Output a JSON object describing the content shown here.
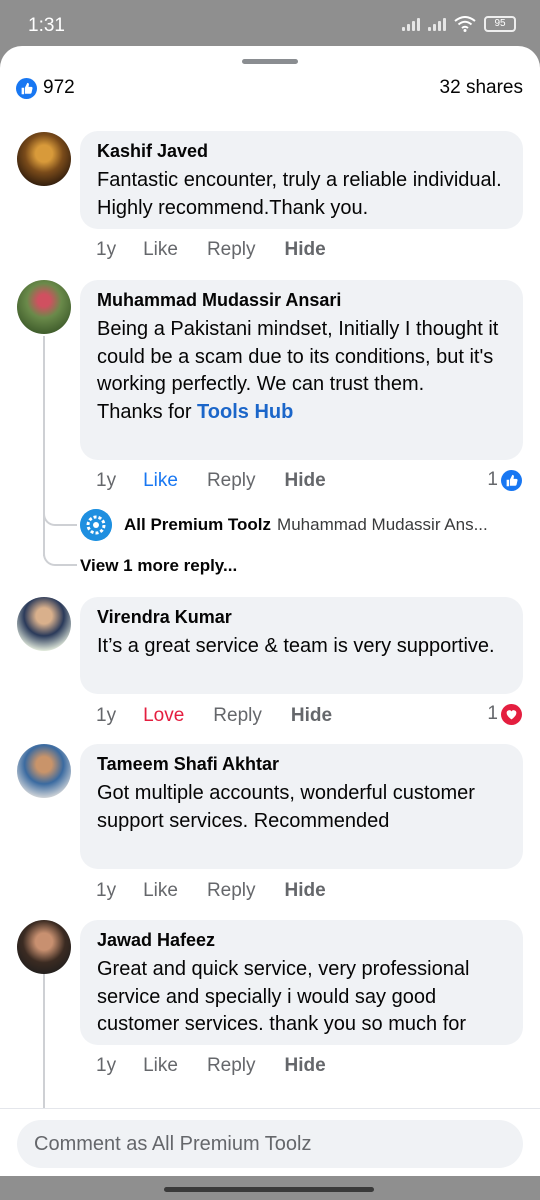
{
  "status": {
    "time": "1:31",
    "battery": "95"
  },
  "header": {
    "like_count": "972",
    "shares": "32 shares"
  },
  "comments": [
    {
      "author": "Kashif Javed",
      "text": "Fantastic encounter, truly a reliable individual. Highly recommend.Thank you.",
      "time": "1y",
      "like": "Like",
      "reply": "Reply",
      "hide": "Hide"
    },
    {
      "author": "Muhammad Mudassir Ansari",
      "text": "Being a Pakistani mindset, Initially I thought it could be a scam due to its conditions, but it's working perfectly. We can trust them.",
      "text2_prefix": "Thanks for ",
      "text2_link": "Tools Hub",
      "time": "1y",
      "like": "Like",
      "reply": "Reply",
      "hide": "Hide",
      "reaction_count": "1",
      "reply_preview": {
        "author": "All Premium Toolz",
        "snippet": "Muhammad Mudassir Ans..."
      },
      "more_replies": "View 1 more reply..."
    },
    {
      "author": "Virendra Kumar",
      "text": "It’s a great service & team is very supportive.",
      "time": "1y",
      "like": "Love",
      "reply": "Reply",
      "hide": "Hide",
      "reaction_count": "1"
    },
    {
      "author": "Tameem Shafi Akhtar",
      "text": "Got multiple accounts, wonderful customer support services. Recommended",
      "time": "1y",
      "like": "Like",
      "reply": "Reply",
      "hide": "Hide"
    },
    {
      "author": "Jawad Hafeez",
      "text": "Great and quick service, very professional service and specially i would say good customer services. thank you so much for",
      "time": "1y",
      "like": "Like",
      "reply": "Reply",
      "hide": "Hide"
    }
  ],
  "composer": {
    "placeholder": "Comment as All Premium Toolz"
  },
  "colors": {
    "accent": "#1877f2",
    "love": "#e41e3f",
    "bubble": "#f0f2f5"
  }
}
